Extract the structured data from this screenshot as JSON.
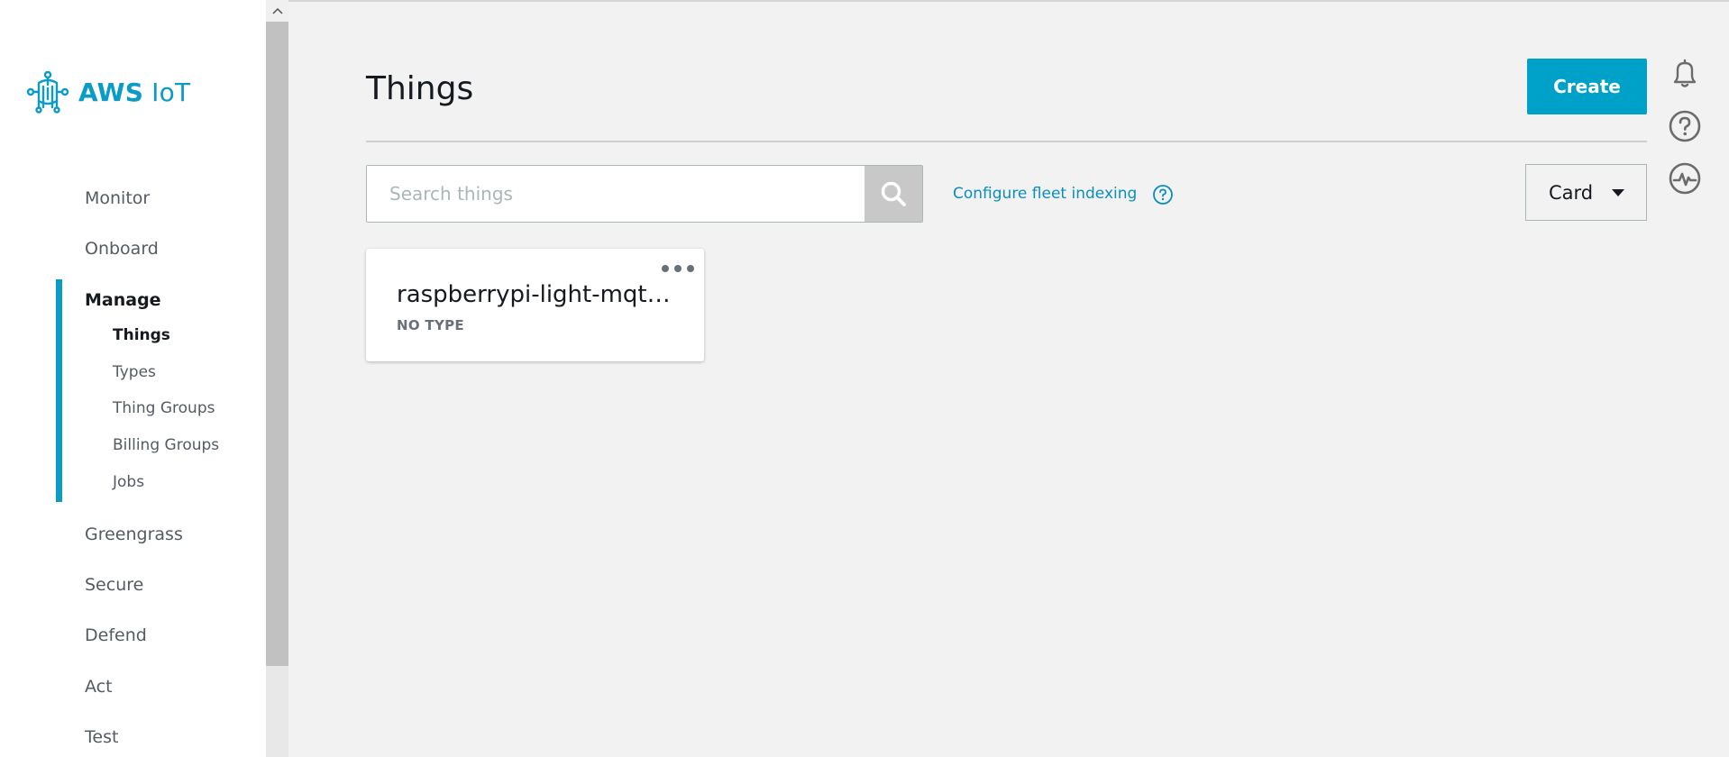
{
  "app": {
    "logo_bold": "AWS",
    "logo_text": " IoT"
  },
  "sidebar": {
    "items": [
      {
        "label": "Monitor"
      },
      {
        "label": "Onboard"
      },
      {
        "label": "Manage"
      },
      {
        "label": "Greengrass"
      },
      {
        "label": "Secure"
      },
      {
        "label": "Defend"
      },
      {
        "label": "Act"
      },
      {
        "label": "Test"
      }
    ],
    "manage_sub": [
      {
        "label": "Things"
      },
      {
        "label": "Types"
      },
      {
        "label": "Thing Groups"
      },
      {
        "label": "Billing Groups"
      },
      {
        "label": "Jobs"
      }
    ],
    "active_item": "Manage",
    "active_sub": "Things"
  },
  "header": {
    "title": "Things",
    "create_label": "Create"
  },
  "search": {
    "placeholder": "Search things",
    "value": ""
  },
  "fleet": {
    "link_label": "Configure fleet indexing"
  },
  "view": {
    "selected": "Card"
  },
  "things": [
    {
      "name": "raspberrypi-light-mqtt-thing",
      "type": "NO TYPE"
    }
  ],
  "colors": {
    "accent": "#00a1c9",
    "link": "#0a8fba"
  }
}
